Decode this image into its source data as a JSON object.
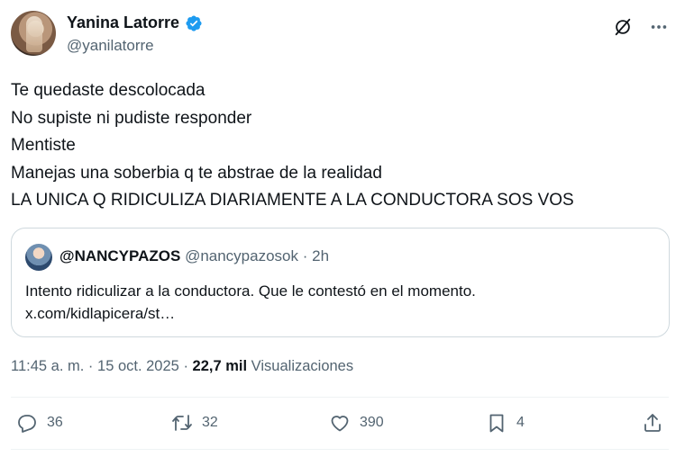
{
  "author": {
    "display_name": "Yanina Latorre",
    "handle": "@yanilatorre",
    "verified": true
  },
  "tweet": {
    "lines": [
      "Te quedaste descolocada",
      "No supiste ni pudiste responder",
      "Mentiste",
      "Manejas una soberbia q te abstrae de la realidad",
      "LA UNICA Q RIDICULIZA DIARIAMENTE A LA CONDUCTORA SOS VOS"
    ]
  },
  "quoted": {
    "display_name": "@NANCYPAZOS",
    "handle": "@nancypazosok",
    "separator": "·",
    "time_ago": "2h",
    "body_line1": "Intento ridiculizar a la conductora. Que le contestó en el momento.",
    "body_line2": "x.com/kidlapicera/st…"
  },
  "meta": {
    "time": "11:45 a. m.",
    "dot": "·",
    "date": "15 oct. 2025",
    "views_count": "22,7 mil",
    "views_label": "Visualizaciones"
  },
  "actions": {
    "replies": "36",
    "reposts": "32",
    "likes": "390",
    "bookmarks": "4"
  },
  "icons": {
    "verified": "verified-badge-icon",
    "grok": "grok-icon",
    "more": "more-icon",
    "reply": "reply-icon",
    "repost": "repost-icon",
    "like": "heart-icon",
    "bookmark": "bookmark-icon",
    "share": "share-icon"
  },
  "colors": {
    "text": "#0f1419",
    "secondary": "#536471",
    "verified_blue": "#1d9bf0",
    "border": "#cfd9de"
  }
}
